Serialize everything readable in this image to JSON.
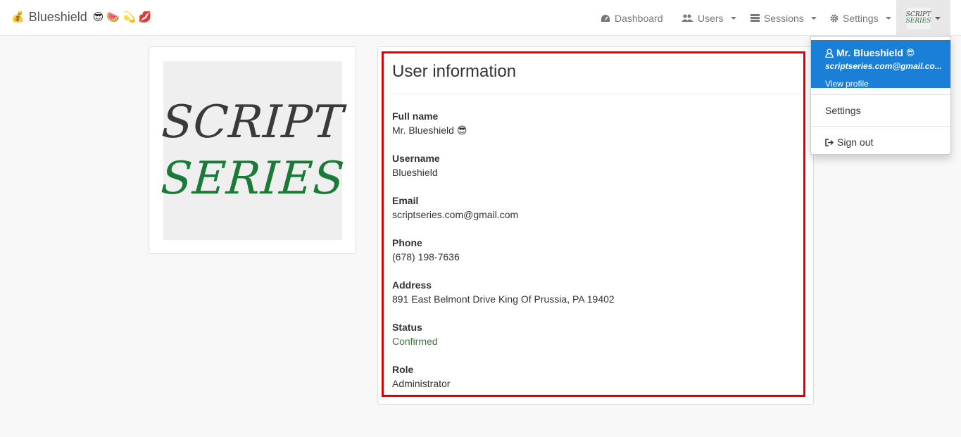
{
  "brand": {
    "name": "Blueshield",
    "emojis": [
      "💰",
      "😎",
      "🍉",
      "💫",
      "💋"
    ]
  },
  "nav": {
    "dashboard": "Dashboard",
    "users": "Users",
    "sessions": "Sessions",
    "settings": "Settings",
    "icons": {
      "dashboard": "dashboard-gauge-icon",
      "users": "users-icon",
      "sessions": "list-icon",
      "settings": "gear-icon"
    }
  },
  "logo": {
    "line1": "SCRIPT",
    "line2": "SERIES",
    "colors": {
      "line1": "#3a3a3a",
      "line2": "#1a7a37"
    }
  },
  "user_info": {
    "title": "User information",
    "fields": [
      {
        "label": "Full name",
        "value": "Mr. Blueshield 😎"
      },
      {
        "label": "Username",
        "value": "Blueshield"
      },
      {
        "label": "Email",
        "value": "scriptseries.com@gmail.com"
      },
      {
        "label": "Phone",
        "value": "(678) 198-7636"
      },
      {
        "label": "Address",
        "value": "891 East Belmont Drive King Of Prussia, PA 19402"
      },
      {
        "label": "Status",
        "value": "Confirmed"
      },
      {
        "label": "Role",
        "value": "Administrator"
      }
    ]
  },
  "dropdown": {
    "name": "Mr. Blueshield",
    "name_emoji": "😎",
    "email": "scriptseries.com@gmail.co...",
    "view_profile": "View profile",
    "settings": "Settings",
    "sign_out": "Sign out"
  },
  "colors": {
    "highlight_border": "#e00000",
    "dropdown_header": "#1a7fd6",
    "status_confirmed": "#3c763d"
  }
}
